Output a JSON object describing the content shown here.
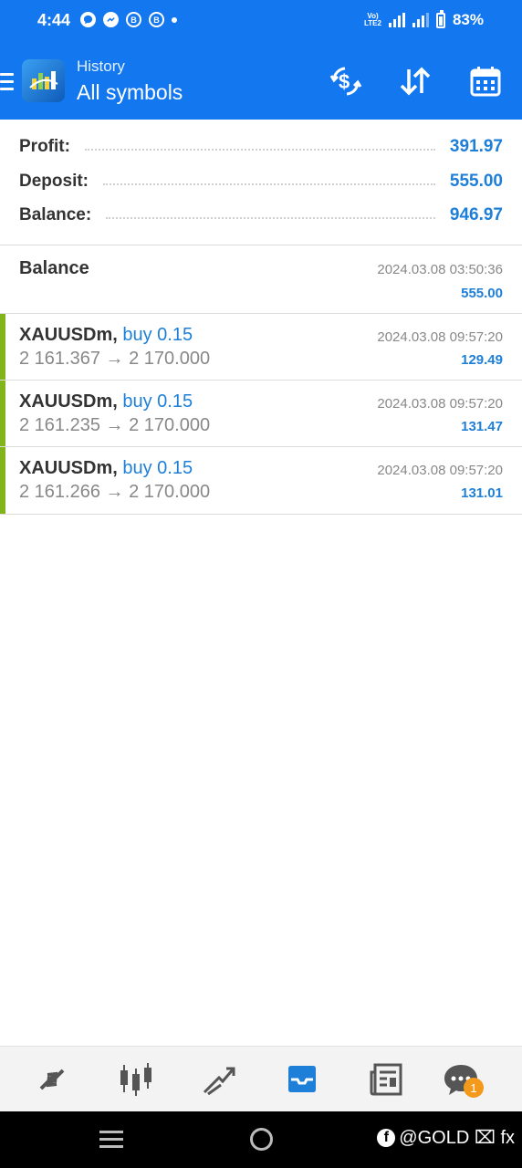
{
  "status_bar": {
    "time": "4:44",
    "network": "Vo) LTE2",
    "battery": "83%",
    "notification_icons": [
      "chat-bubble-icon",
      "messenger-icon",
      "bitcoin-icon",
      "bitcoin-icon",
      "dot-icon"
    ]
  },
  "header": {
    "subtitle": "History",
    "title": "All symbols",
    "actions": [
      "currency-exchange-icon",
      "sort-icon",
      "calendar-icon"
    ]
  },
  "summary": {
    "profit_label": "Profit:",
    "profit_value": "391.97",
    "deposit_label": "Deposit:",
    "deposit_value": "555.00",
    "balance_label": "Balance:",
    "balance_value": "946.97"
  },
  "history": [
    {
      "title": "Balance",
      "date": "2024.03.08 03:50:36",
      "amount": "555.00"
    },
    {
      "symbol": "XAUUSDm,",
      "action": "buy 0.15",
      "prices": "2 161.367 → 2 170.000",
      "date": "2024.03.08 09:57:20",
      "amount": "129.49"
    },
    {
      "symbol": "XAUUSDm,",
      "action": "buy 0.15",
      "prices": "2 161.235 → 2 170.000",
      "date": "2024.03.08 09:57:20",
      "amount": "131.47"
    },
    {
      "symbol": "XAUUSDm,",
      "action": "buy 0.15",
      "prices": "2 161.266 → 2 170.000",
      "date": "2024.03.08 09:57:20",
      "amount": "131.01"
    }
  ],
  "bottom_nav": {
    "items": [
      "quotes-icon",
      "chart-icon",
      "trade-icon",
      "history-icon",
      "news-icon",
      "chat-icon"
    ],
    "active": "history-icon",
    "chat_badge": "1"
  },
  "watermark": {
    "fb_letter": "f",
    "text": "@GOLD ⌧ fx"
  },
  "colors": {
    "primary": "#1377f0",
    "accent_blue": "#1e7fd8",
    "buy_bar": "#82b51c",
    "badge": "#f39a1c"
  }
}
